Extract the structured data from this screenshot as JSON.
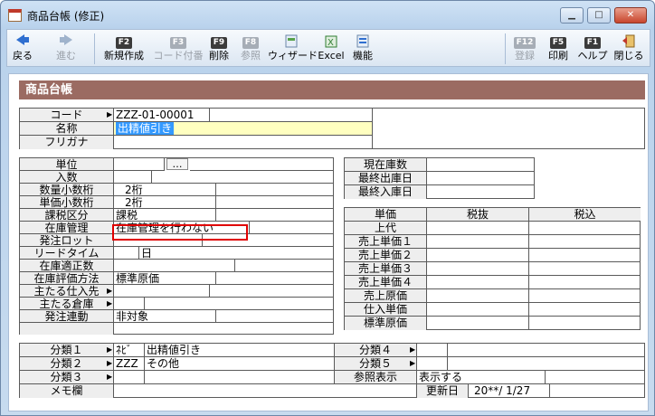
{
  "window": {
    "title": "商品台帳 (修正)",
    "minimize": "▁",
    "maximize": "□",
    "close": "✕"
  },
  "toolbar": {
    "back": "戻る",
    "forward": "進む",
    "new": "新規作成",
    "copy": "コード付番",
    "delete": "削除",
    "refer": "参照",
    "wizard": "ウィザード",
    "excel": "Excel",
    "func": "機能",
    "register": "登録",
    "print": "印刷",
    "help": "ヘルプ",
    "close": "閉じる",
    "f2": "F2",
    "f3": "F3",
    "f9": "F9",
    "f8": "F8",
    "f12": "F12",
    "f5": "F5",
    "f1": "F1"
  },
  "header": {
    "title": "商品台帳"
  },
  "basic": {
    "code_label": "コード",
    "code_value": "ZZZ-01-00001",
    "name_label": "名称",
    "name_value": "出精値引き",
    "furigana_label": "フリガナ",
    "furigana_value": ""
  },
  "detail": {
    "unit_label": "単位",
    "unit_btn": "…",
    "qty_label": "入数",
    "qty_dec_label": "数量小数桁",
    "qty_dec_value": "2桁",
    "price_dec_label": "単価小数桁",
    "price_dec_value": "2桁",
    "tax_label": "課税区分",
    "tax_value": "課税",
    "stock_label": "在庫管理",
    "stock_value": "在庫管理を行わない",
    "order_lot_label": "発注ロット",
    "lead_label": "リードタイム",
    "lead_unit": "日",
    "proper_label": "在庫適正数",
    "eval_label": "在庫評価方法",
    "eval_value": "標準原価",
    "supplier_label": "主たる仕入先",
    "warehouse_label": "主たる倉庫",
    "order_link_label": "発注連動",
    "order_link_value": "非対象"
  },
  "stock": {
    "current_label": "現在庫数",
    "last_out_label": "最終出庫日",
    "last_in_label": "最終入庫日"
  },
  "price": {
    "col_unit": "単価",
    "col_ex": "税抜",
    "col_in": "税込",
    "rows": [
      "上代",
      "売上単価１",
      "売上単価２",
      "売上単価３",
      "売上単価４",
      "売上原価",
      "仕入単価",
      "標準原価"
    ]
  },
  "class": {
    "c1_label": "分類１",
    "c1_code": "ﾈﾋﾞ",
    "c1_name": "出精値引き",
    "c2_label": "分類２",
    "c2_code": "ZZZ",
    "c2_name": "その他",
    "c3_label": "分類３",
    "c4_label": "分類４",
    "c5_label": "分類５",
    "ref_label": "参照表示",
    "ref_value": "表示する",
    "memo_label": "メモ欄",
    "updated_label": "更新日",
    "updated_value": "20**/ 1/27"
  }
}
